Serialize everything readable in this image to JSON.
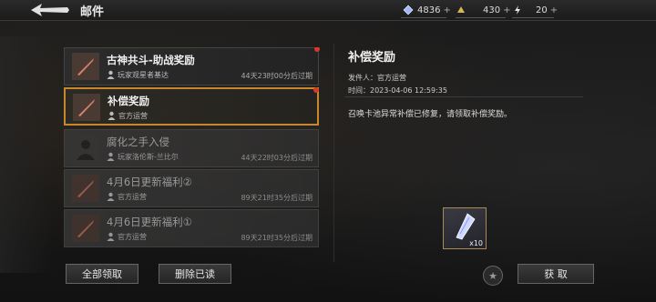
{
  "header": {
    "title": "邮件",
    "resources": [
      {
        "icon": "diamond-icon",
        "value": "4836"
      },
      {
        "icon": "gold-icon",
        "value": "430"
      },
      {
        "icon": "lightning-icon",
        "value": "20"
      }
    ],
    "plus": "+"
  },
  "mails": [
    {
      "title": "古神共斗-助战奖励",
      "sender": "玩家观星者基达",
      "expire": "44天23时00分后过期",
      "state": "unread"
    },
    {
      "title": "补偿奖励",
      "sender": "官方运营",
      "expire": "",
      "state": "selected"
    },
    {
      "title": "腐化之手入侵",
      "sender": "玩家洛伦斯-兰比尔",
      "expire": "44天22时03分后过期",
      "state": "read"
    },
    {
      "title": "4月6日更新福利②",
      "sender": "官方运营",
      "expire": "89天21时35分后过期",
      "state": "read"
    },
    {
      "title": "4月6日更新福利①",
      "sender": "官方运营",
      "expire": "89天21时35分后过期",
      "state": "read"
    }
  ],
  "actions": {
    "claim_all": "全部领取",
    "delete_read": "删除已读",
    "claim": "获 取"
  },
  "detail": {
    "title": "补偿奖励",
    "sender": "发件人：官方运营",
    "time": "时间：2023-04-06 12:59:35",
    "body": "召唤卡池异常补偿已修复，请领取补偿奖励。",
    "attachment": {
      "qty": "x10"
    }
  },
  "colors": {
    "accent": "#c9872d",
    "unread_dot": "#d23a2a"
  }
}
